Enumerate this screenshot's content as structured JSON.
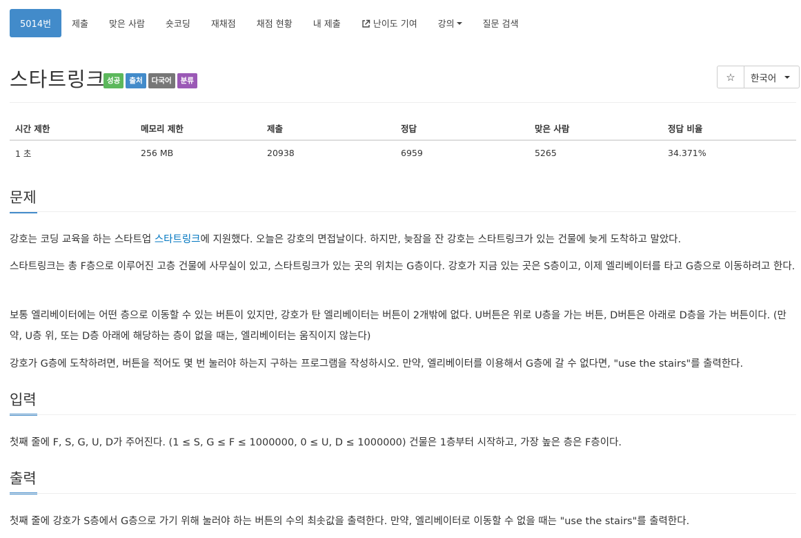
{
  "nav": {
    "items": [
      {
        "label": "5014번",
        "active": true
      },
      {
        "label": "제출"
      },
      {
        "label": "맞은 사람"
      },
      {
        "label": "숏코딩"
      },
      {
        "label": "재채점"
      },
      {
        "label": "채점 현황"
      },
      {
        "label": "내 제출"
      },
      {
        "label": "난이도 기여",
        "icon": "external-link-icon"
      },
      {
        "label": "강의",
        "icon": "caret-down-icon"
      },
      {
        "label": "질문 검색"
      }
    ]
  },
  "problem": {
    "title": "스타트링크",
    "labels": [
      {
        "text": "성공",
        "color": "#5cb85c"
      },
      {
        "text": "출처",
        "color": "#428bca"
      },
      {
        "text": "다국어",
        "color": "#777777"
      },
      {
        "text": "분류",
        "color": "#9b59b6"
      }
    ]
  },
  "toolbar": {
    "star_icon": "star-outline-icon",
    "star_glyph": "☆",
    "language": "한국어"
  },
  "info_table": {
    "headers": [
      "시간 제한",
      "메모리 제한",
      "제출",
      "정답",
      "맞은 사람",
      "정답 비율"
    ],
    "values": [
      "1 초",
      "256 MB",
      "20938",
      "6959",
      "5265",
      "34.371%"
    ]
  },
  "sections": {
    "problem_title": "문제",
    "input_title": "입력",
    "output_title": "출력"
  },
  "description": {
    "p1_before": "강호는 코딩 교육을 하는 스타트업 ",
    "p1_link": "스타트링크",
    "p1_after": "에 지원했다. 오늘은 강호의 면접날이다. 하지만, 늦잠을 잔 강호는 스타트링크가 있는 건물에 늦게 도착하고 말았다.",
    "p2": "스타트링크는 총 F층으로 이루어진 고층 건물에 사무실이 있고, 스타트링크가 있는 곳의 위치는 G층이다. 강호가 지금 있는 곳은 S층이고, 이제 엘리베이터를 타고 G층으로 이동하려고 한다.",
    "p3": "보통 엘리베이터에는 어떤 층으로 이동할 수 있는 버튼이 있지만, 강호가 탄 엘리베이터는 버튼이 2개밖에 없다. U버튼은 위로 U층을 가는 버튼, D버튼은 아래로 D층을 가는 버튼이다. (만약, U층 위, 또는 D층 아래에 해당하는 층이 없을 때는, 엘리베이터는 움직이지 않는다)",
    "p4": "강호가 G층에 도착하려면, 버튼을 적어도 몇 번 눌러야 하는지 구하는 프로그램을 작성하시오. 만약, 엘리베이터를 이용해서 G층에 갈 수 없다면, \"use the stairs\"를 출력한다."
  },
  "input_text": "첫째 줄에 F, S, G, U, D가 주어진다. (1 ≤ S, G ≤ F ≤ 1000000, 0 ≤ U, D ≤ 1000000) 건물은 1층부터 시작하고, 가장 높은 층은 F층이다.",
  "output_text": "첫째 줄에 강호가 S층에서 G층으로 가기 위해 눌러야 하는 버튼의 수의 최솟값을 출력한다. 만약, 엘리베이터로 이동할 수 없을 때는 \"use the stairs\"를 출력한다."
}
